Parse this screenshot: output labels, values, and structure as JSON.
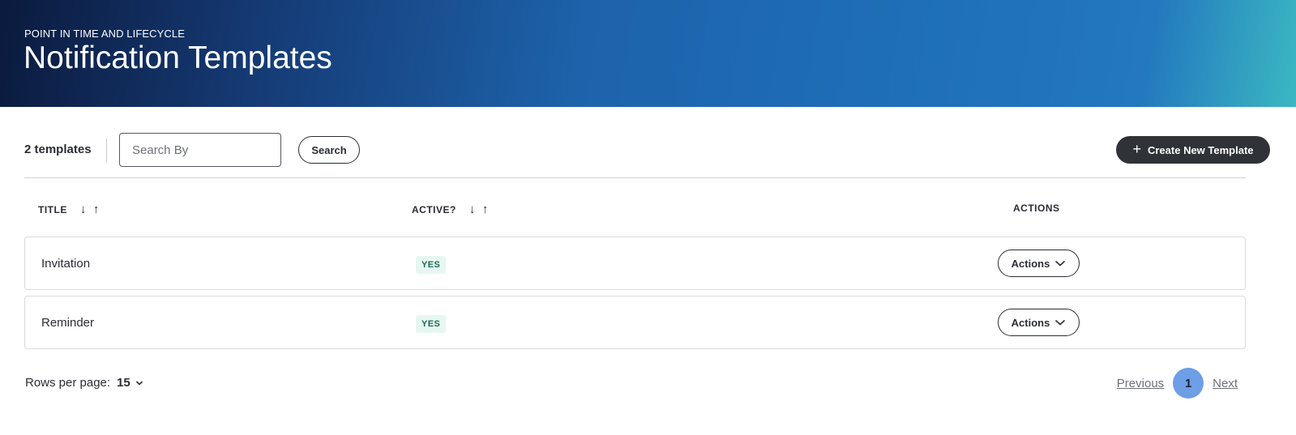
{
  "header": {
    "subtitle": "POINT IN TIME AND LIFECYCLE",
    "title": "Notification Templates"
  },
  "toolbar": {
    "count_label": "2 templates",
    "search_placeholder": "Search By",
    "search_button": "Search",
    "create_icon": "plus-icon",
    "create_button": "Create New Template"
  },
  "table": {
    "columns": [
      {
        "label": "TITLE",
        "sort_down_icon": "↓",
        "sort_up_icon": "↑"
      },
      {
        "label": "ACTIVE?",
        "sort_down_icon": "↓",
        "sort_up_icon": "↑"
      },
      {
        "label": "ACTIONS"
      }
    ],
    "rows": [
      {
        "title": "Invitation",
        "active": "YES",
        "action_label": "Actions"
      },
      {
        "title": "Reminder",
        "active": "YES",
        "action_label": "Actions"
      }
    ]
  },
  "footer": {
    "rows_per_page_label": "Rows per page:",
    "rows_per_page_value": "15",
    "previous": "Previous",
    "current_page": "1",
    "next": "Next"
  },
  "colors": {
    "hero_dark": "#0b1a3d",
    "hero_blue": "#1e6fb8",
    "hero_teal": "#3bb8c2",
    "primary_button": "#2f3237",
    "active_badge_bg": "#e6f7f1",
    "active_badge_text": "#1e6b52",
    "current_page_bg": "#6d9ee6"
  }
}
